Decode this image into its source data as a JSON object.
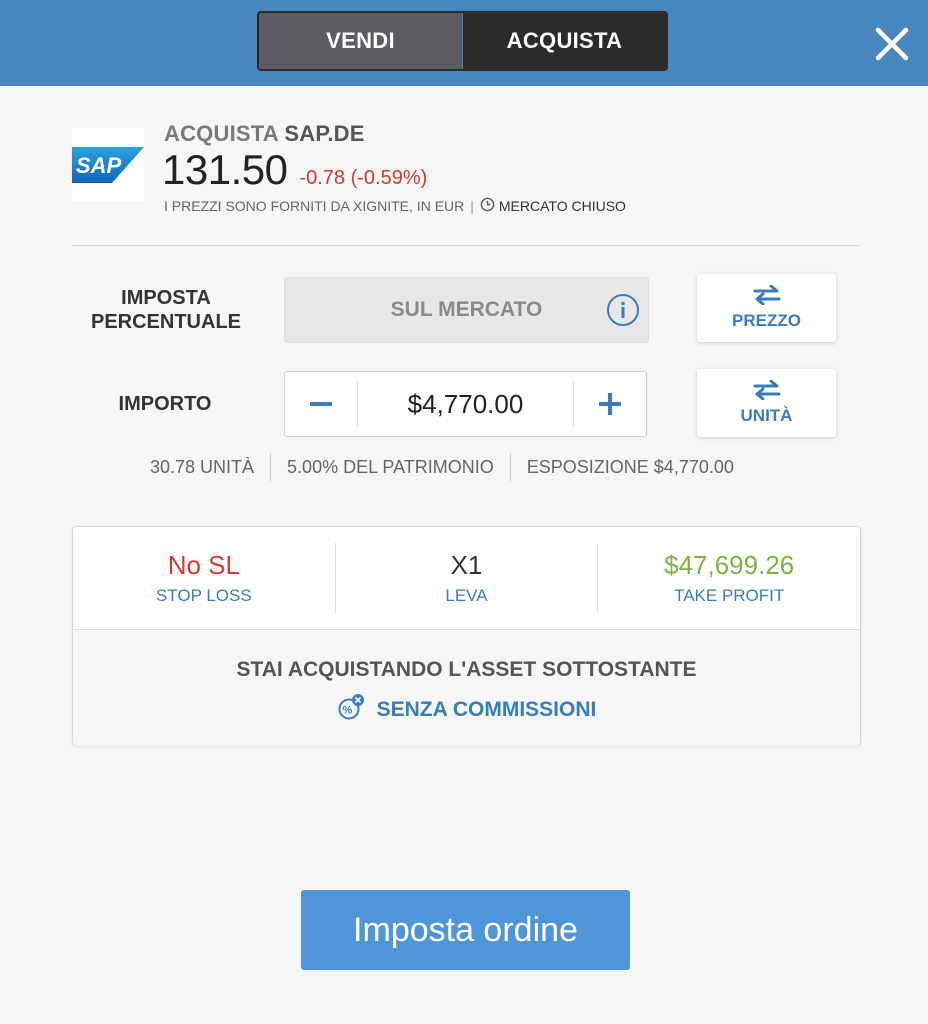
{
  "header": {
    "tabs": [
      {
        "label": "VENDI",
        "selected": true
      },
      {
        "label": "ACQUISTA",
        "selected": false
      }
    ],
    "close_icon": "close-icon",
    "color": "#4a86be"
  },
  "asset": {
    "logo_text": "SAP",
    "action": "ACQUISTA",
    "symbol": "SAP.DE",
    "price": "131.50",
    "change": "-0.78 (-0.59%)",
    "price_source": "I PREZZI SONO FORNITI DA XIGNITE, IN EUR",
    "separator": "|",
    "market_status": "MERCATO CHIUSO"
  },
  "order": {
    "rate_label_line1": "IMPOSTA",
    "rate_label_line2": "PERCENTUALE",
    "rate_value": "SUL MERCATO",
    "rate_switch_label": "PREZZO",
    "amount_label": "IMPORTO",
    "amount_value": "$4,770.00",
    "amount_switch_label": "UNITÀ",
    "units": "30.78 UNITÀ",
    "equity": "5.00% DEL PATRIMONIO",
    "exposure": "ESPOSIZIONE $4,770.00"
  },
  "stats": {
    "stop_loss_value": "No SL",
    "stop_loss_label": "STOP LOSS",
    "leverage_value": "X1",
    "leverage_label": "LEVA",
    "take_profit_value": "$47,699.26",
    "take_profit_label": "TAKE PROFIT"
  },
  "notice": {
    "underlying": "STAI ACQUISTANDO L'ASSET SOTTOSTANTE",
    "commission": "SENZA COMMISSIONI"
  },
  "submit_label": "Imposta ordine",
  "colors": {
    "accent": "#3a7cc0",
    "negative": "#d23a33",
    "positive": "#7fb33f",
    "button": "#4f96d8"
  }
}
